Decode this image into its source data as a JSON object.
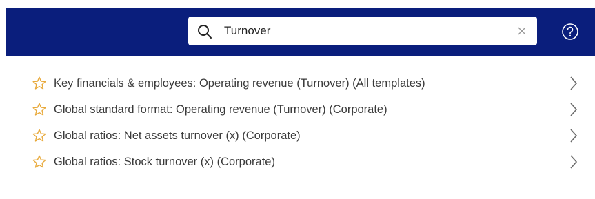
{
  "search": {
    "value": "Turnover",
    "icon": "search-icon",
    "clear_icon": "close-icon"
  },
  "header": {
    "background_color": "#0a1e7c",
    "help_icon": "help-circle-icon"
  },
  "results": [
    {
      "label": "Key financials & employees: Operating revenue (Turnover) (All templates)"
    },
    {
      "label": "Global standard format: Operating revenue (Turnover) (Corporate)"
    },
    {
      "label": "Global ratios: Net assets turnover (x) (Corporate)"
    },
    {
      "label": "Global ratios: Stock turnover (x) (Corporate)"
    }
  ],
  "colors": {
    "star_outline": "#e8a93a",
    "chevron": "#6b6b6b"
  }
}
